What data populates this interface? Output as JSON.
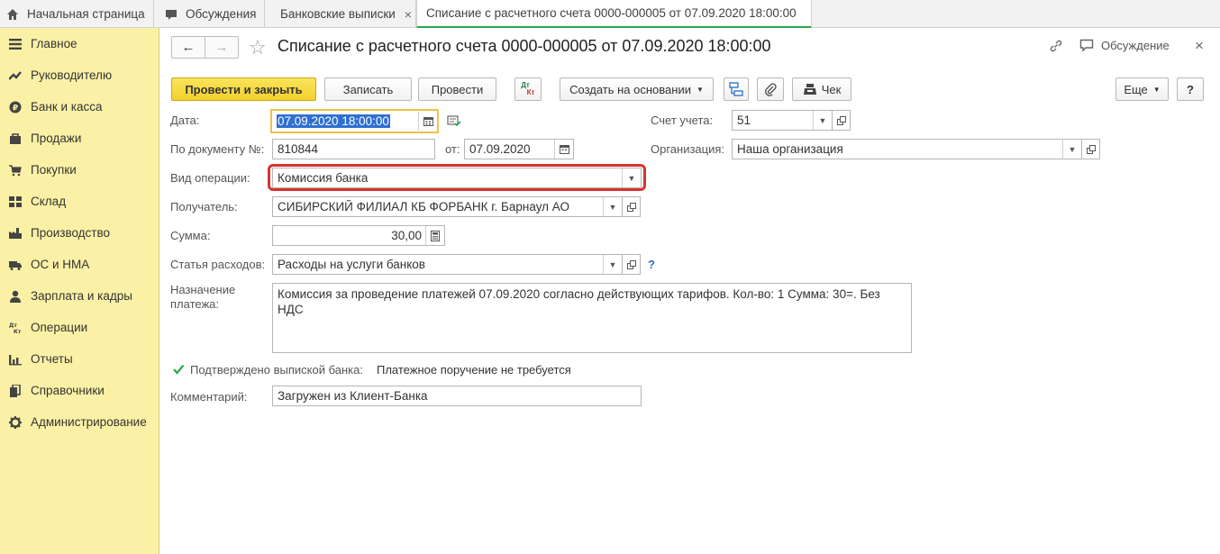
{
  "tabs": [
    {
      "label": "Начальная страница",
      "icon": "home-icon"
    },
    {
      "label": "Обсуждения",
      "icon": "chat-icon"
    },
    {
      "label": "Банковские выписки",
      "close": "×"
    },
    {
      "label": "Списание с расчетного счета 0000-000005 от 07.09.2020 18:00:00"
    }
  ],
  "sidebar": {
    "items": [
      {
        "label": "Главное",
        "icon": "menu-icon"
      },
      {
        "label": "Руководителю",
        "icon": "trend-icon"
      },
      {
        "label": "Банк и касса",
        "icon": "ruble-icon"
      },
      {
        "label": "Продажи",
        "icon": "bag-icon"
      },
      {
        "label": "Покупки",
        "icon": "cart-icon"
      },
      {
        "label": "Склад",
        "icon": "warehouse-icon"
      },
      {
        "label": "Производство",
        "icon": "factory-icon"
      },
      {
        "label": "ОС и НМА",
        "icon": "truck-icon"
      },
      {
        "label": "Зарплата и кадры",
        "icon": "person-icon"
      },
      {
        "label": "Операции",
        "icon": "dt-kt-icon"
      },
      {
        "label": "Отчеты",
        "icon": "bar-chart-icon"
      },
      {
        "label": "Справочники",
        "icon": "books-icon"
      },
      {
        "label": "Администрирование",
        "icon": "gear-icon"
      }
    ]
  },
  "header": {
    "title": "Списание с расчетного счета 0000-000005 от 07.09.2020 18:00:00",
    "discussion_label": "Обсуждение",
    "close_glyph": "×",
    "back_glyph": "←",
    "forward_glyph": "→",
    "star_glyph": "☆"
  },
  "toolbar": {
    "post_close": "Провести и закрыть",
    "save": "Записать",
    "post": "Провести",
    "dtkt_top": "Дт",
    "dtkt_bottom": "Кт",
    "create_based": "Создать на основании",
    "check": "Чек",
    "more": "Еще",
    "help": "?"
  },
  "form": {
    "date_label": "Дата:",
    "date_value": "07.09.2020 18:00:00",
    "account_label": "Счет учета:",
    "account_value": "51",
    "doc_label": "По документу №:",
    "doc_value": "810844",
    "from_label": "от:",
    "from_value": "07.09.2020",
    "org_label": "Организация:",
    "org_value": "Наша организация",
    "op_label": "Вид операции:",
    "op_value": "Комиссия банка",
    "recipient_label": "Получатель:",
    "recipient_value": "СИБИРСКИЙ ФИЛИАЛ КБ ФОРБАНК г. Барнаул АО",
    "sum_label": "Сумма:",
    "sum_value": "30,00",
    "expense_label": "Статья расходов:",
    "expense_value": "Расходы на услуги банков",
    "expense_help": "?",
    "purpose_label_1": "Назначение",
    "purpose_label_2": "платежа:",
    "purpose_value": "Комиссия за проведение платежей 07.09.2020 согласно действующих тарифов.  Кол-во: 1 Сумма: 30=. Без НДС",
    "confirmed_label": "Подтверждено выпиской банка:",
    "confirmed_checked": true,
    "payment_order_note": "Платежное поручение не требуется",
    "comment_label": "Комментарий:",
    "comment_value": "Загружен из Клиент-Банка"
  },
  "colors": {
    "sidebar_bg": "#fbf1a6",
    "primary_button": "#f3d12e",
    "active_tab_underline": "#2aa84a",
    "highlight_frame": "#d8332f",
    "date_focus": "#f0c24a",
    "selection": "#2f6fd1"
  }
}
